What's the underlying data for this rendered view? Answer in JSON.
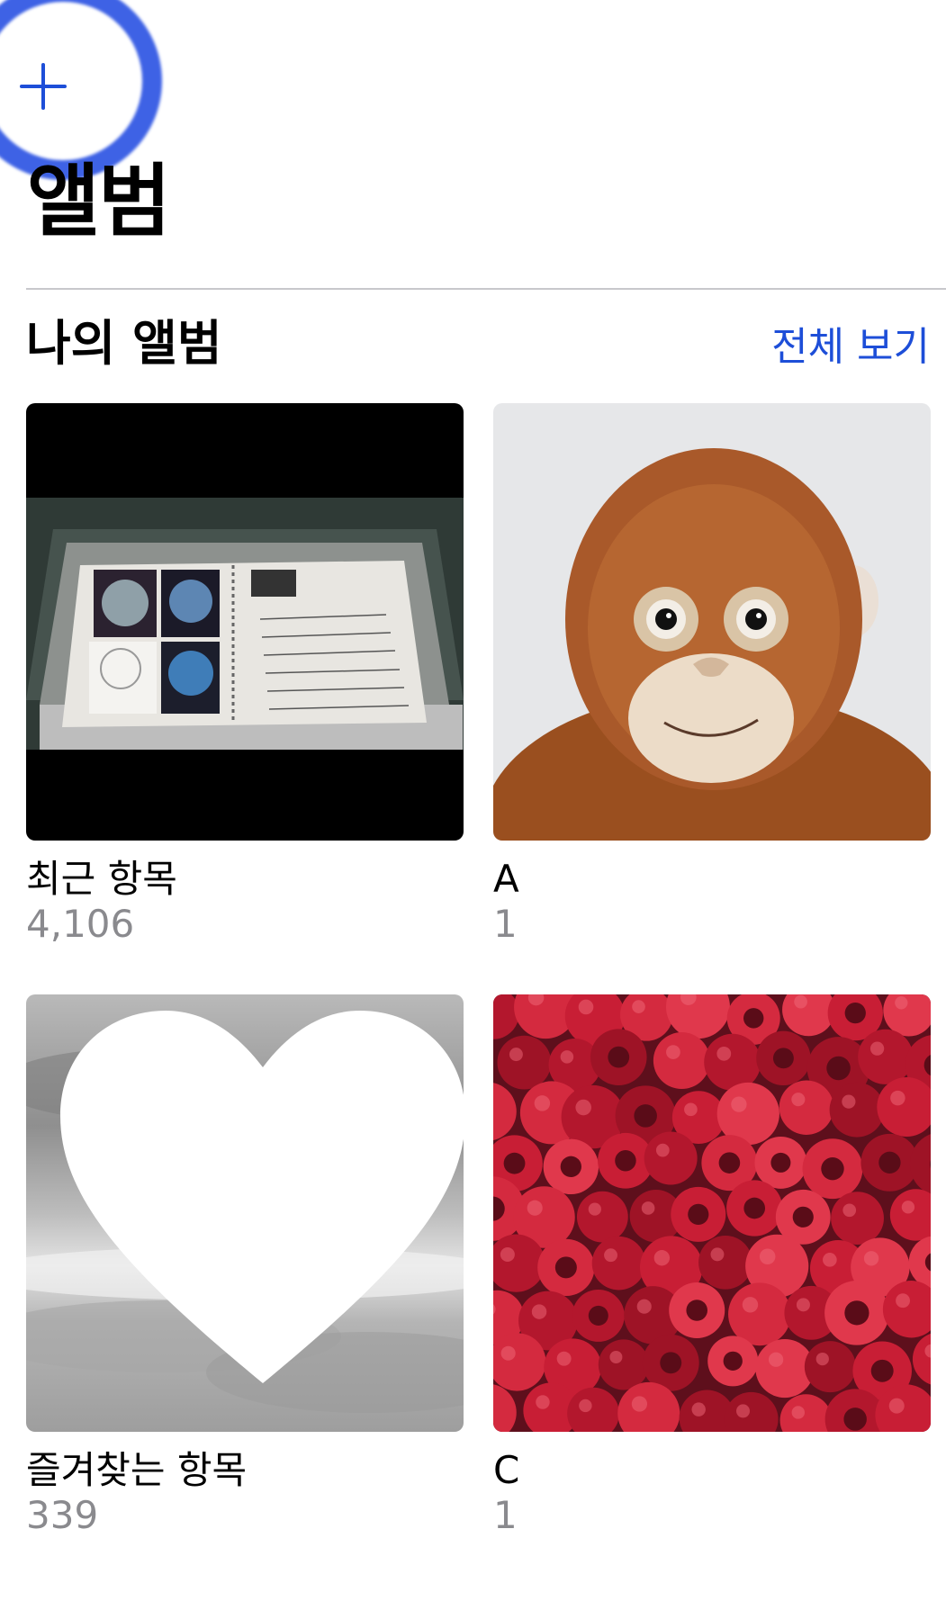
{
  "header": {
    "title": "앨범",
    "add_icon": "plus-icon",
    "accent_color": "#1d4ed8"
  },
  "my_albums": {
    "title": "나의 앨범",
    "see_all": "전체 보기",
    "albums": [
      {
        "name": "최근 항목",
        "count": "4,106",
        "thumbnail": "notebook-display-photo"
      },
      {
        "name": "A",
        "count": "1",
        "thumbnail": "plush-monkey-photo"
      },
      {
        "name": "즐겨찾는 항목",
        "count": "339",
        "thumbnail": "clouds-photo",
        "badge_icon": "heart-icon"
      },
      {
        "name": "C",
        "count": "1",
        "thumbnail": "raspberries-photo"
      }
    ]
  }
}
